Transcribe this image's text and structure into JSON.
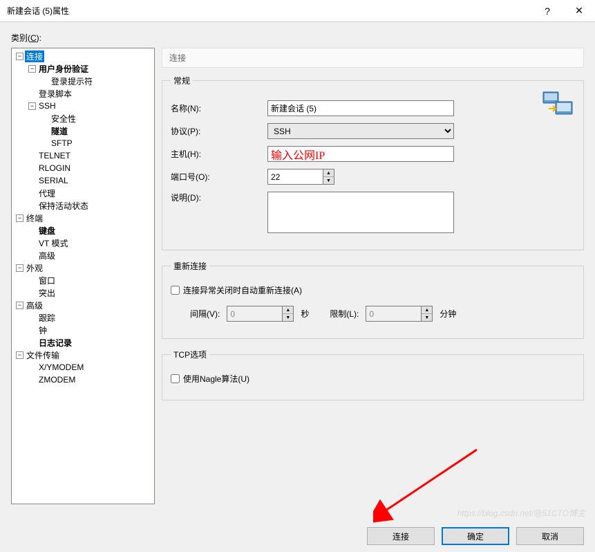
{
  "window": {
    "title": "新建会话 (5)属性",
    "help_icon": "?",
    "close_icon": "✕"
  },
  "category_label_pre": "类别(",
  "category_label_key": "C",
  "category_label_post": "):",
  "tree": {
    "items": [
      {
        "depth": 0,
        "toggle": "-",
        "label": "连接",
        "selected": true
      },
      {
        "depth": 1,
        "toggle": "-",
        "label": "用户身份验证",
        "bold": true
      },
      {
        "depth": 2,
        "label": "登录提示符"
      },
      {
        "depth": 1,
        "label": "登录脚本"
      },
      {
        "depth": 1,
        "toggle": "-",
        "label": "SSH"
      },
      {
        "depth": 2,
        "label": "安全性"
      },
      {
        "depth": 2,
        "label": "隧道",
        "bold": true
      },
      {
        "depth": 2,
        "label": "SFTP"
      },
      {
        "depth": 1,
        "label": "TELNET"
      },
      {
        "depth": 1,
        "label": "RLOGIN"
      },
      {
        "depth": 1,
        "label": "SERIAL"
      },
      {
        "depth": 1,
        "label": "代理"
      },
      {
        "depth": 1,
        "label": "保持活动状态"
      },
      {
        "depth": 0,
        "toggle": "-",
        "label": "终端"
      },
      {
        "depth": 1,
        "label": "键盘",
        "bold": true
      },
      {
        "depth": 1,
        "label": "VT 模式"
      },
      {
        "depth": 1,
        "label": "高级"
      },
      {
        "depth": 0,
        "toggle": "-",
        "label": "外观"
      },
      {
        "depth": 1,
        "label": "窗口"
      },
      {
        "depth": 1,
        "label": "突出"
      },
      {
        "depth": 0,
        "toggle": "-",
        "label": "高级"
      },
      {
        "depth": 1,
        "label": "跟踪"
      },
      {
        "depth": 1,
        "label": "钟"
      },
      {
        "depth": 1,
        "label": "日志记录",
        "bold": true
      },
      {
        "depth": 0,
        "toggle": "-",
        "label": "文件传输"
      },
      {
        "depth": 1,
        "label": "X/YMODEM"
      },
      {
        "depth": 1,
        "label": "ZMODEM"
      }
    ]
  },
  "panel_header": "连接",
  "general": {
    "legend": "常规",
    "name_label": "名称(N):",
    "name_value": "新建会话 (5)",
    "protocol_label": "协议(P):",
    "protocol_value": "SSH",
    "host_label": "主机(H):",
    "host_value": "输入公网IP",
    "port_label": "端口号(O):",
    "port_value": "22",
    "desc_label": "说明(D):",
    "desc_value": ""
  },
  "reconnect": {
    "legend": "重新连接",
    "checkbox_label": "连接异常关闭时自动重新连接(A)",
    "interval_label": "间隔(V):",
    "interval_value": "0",
    "interval_unit": "秒",
    "limit_label": "限制(L):",
    "limit_value": "0",
    "limit_unit": "分钟"
  },
  "tcp": {
    "legend": "TCP选项",
    "nagle_label": "使用Nagle算法(U)"
  },
  "buttons": {
    "connect": "连接",
    "ok": "确定",
    "cancel": "取消"
  },
  "watermark": "https://blog.csdn.net/@51CTO博主"
}
